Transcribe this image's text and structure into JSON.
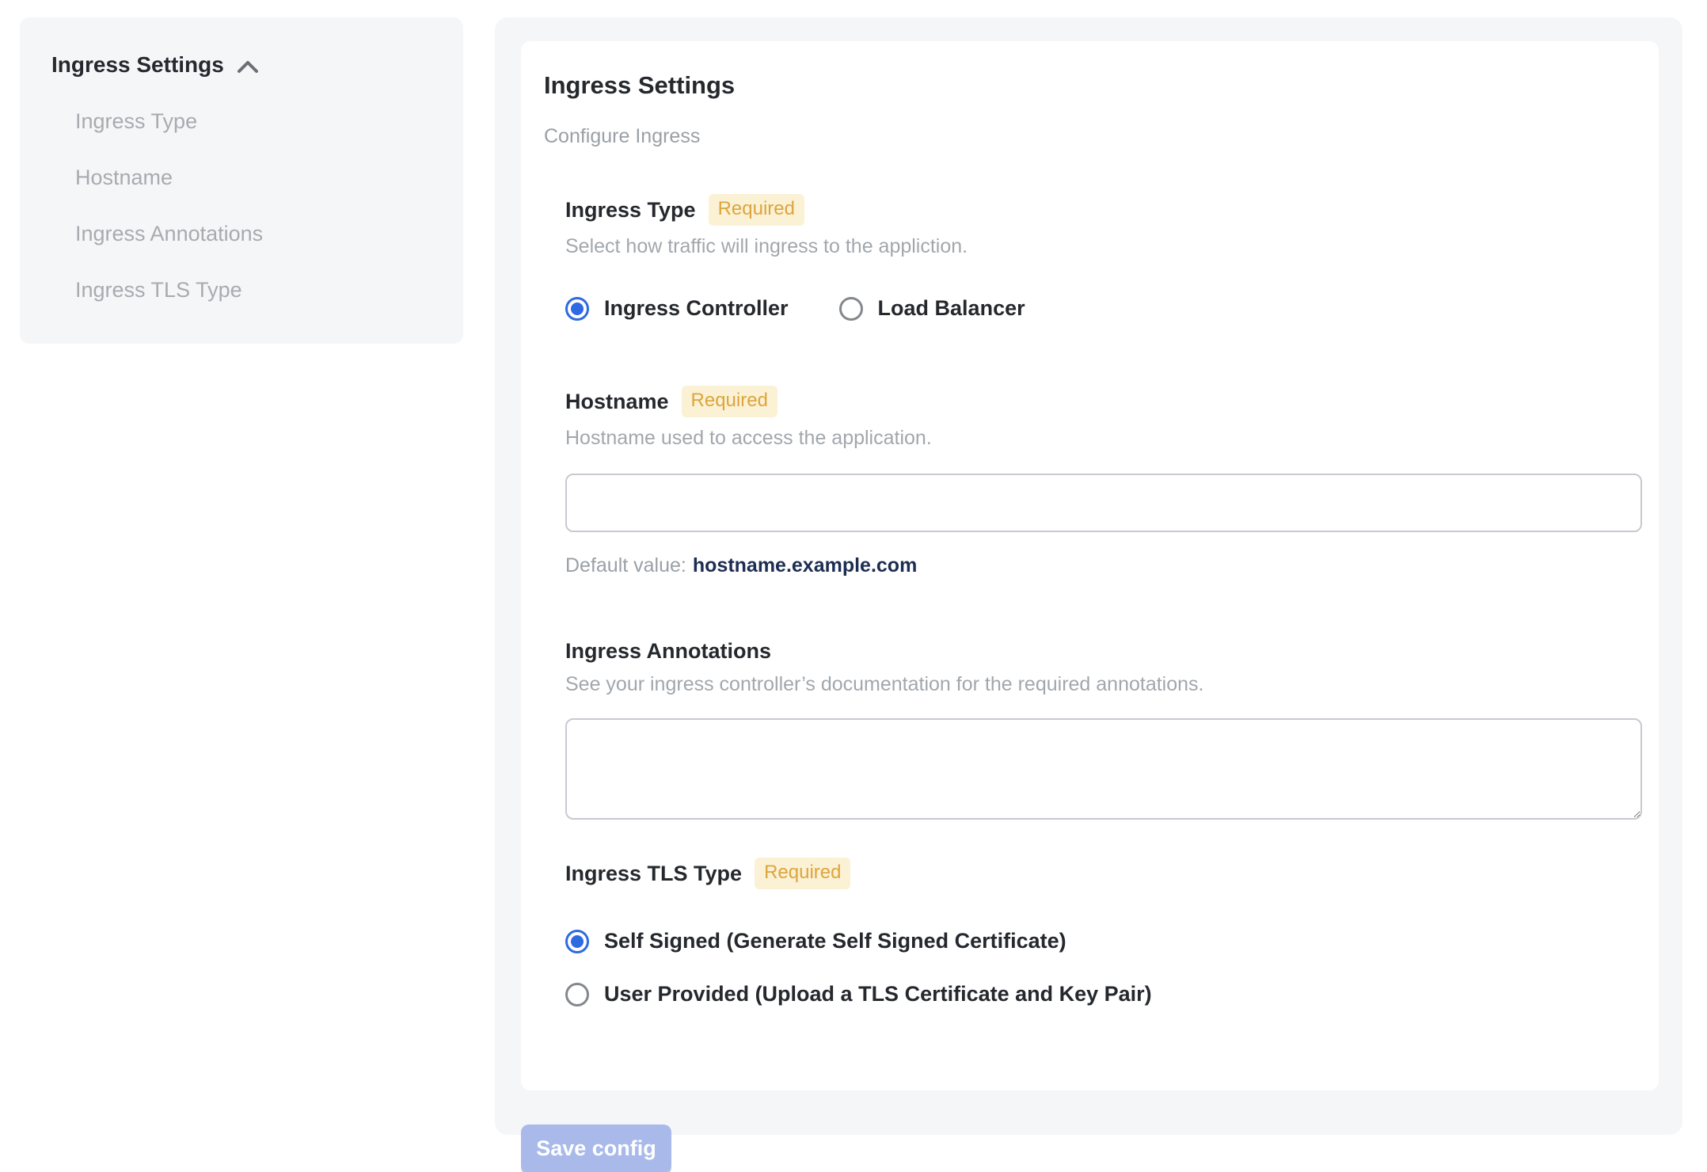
{
  "sidebar": {
    "header": "Ingress Settings",
    "items": [
      {
        "label": "Ingress Type"
      },
      {
        "label": "Hostname"
      },
      {
        "label": "Ingress Annotations"
      },
      {
        "label": "Ingress TLS Type"
      }
    ]
  },
  "main": {
    "title": "Ingress Settings",
    "subtitle": "Configure Ingress",
    "required_badge": "Required",
    "sections": {
      "ingress_type": {
        "label": "Ingress Type",
        "description": "Select how traffic will ingress to the appliction.",
        "options": [
          {
            "label": "Ingress Controller",
            "selected": true
          },
          {
            "label": "Load Balancer",
            "selected": false
          }
        ]
      },
      "hostname": {
        "label": "Hostname",
        "description": "Hostname used to access the application.",
        "value": "",
        "default_label": "Default value:",
        "default_value": "hostname.example.com"
      },
      "annotations": {
        "label": "Ingress Annotations",
        "description": "See your ingress controller’s documentation for the required annotations.",
        "value": ""
      },
      "tls_type": {
        "label": "Ingress TLS Type",
        "options": [
          {
            "label": "Self Signed (Generate Self Signed Certificate)",
            "selected": true
          },
          {
            "label": "User Provided (Upload a TLS Certificate and Key Pair)",
            "selected": false
          }
        ]
      }
    },
    "save_button": "Save config"
  },
  "colors": {
    "accent_blue": "#2e6ae1",
    "badge_bg": "#fbf1d4",
    "badge_text": "#dda53c",
    "button_bg": "#a9baea",
    "panel_bg": "#f5f6f8",
    "default_value_text": "#1c2d52"
  }
}
